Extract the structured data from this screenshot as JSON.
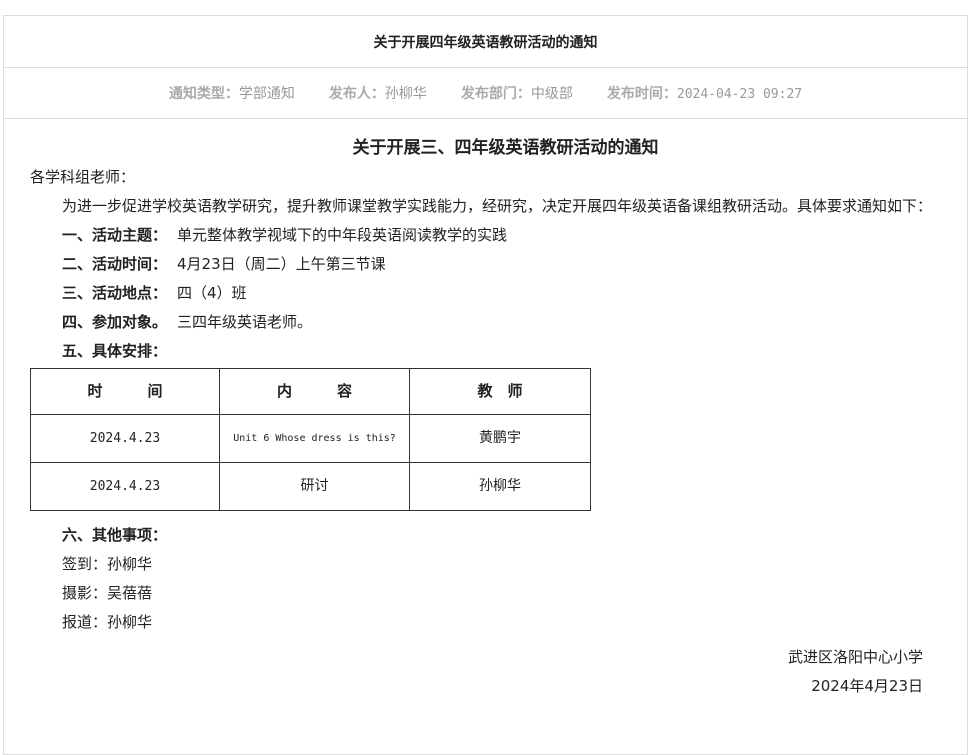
{
  "header": {
    "title": "关于开展四年级英语教研活动的通知"
  },
  "meta": {
    "type_label": "通知类型：",
    "type_value": "学部通知",
    "publisher_label": "发布人：",
    "publisher_value": "孙柳华",
    "dept_label": "发布部门：",
    "dept_value": "中级部",
    "time_label": "发布时间：",
    "time_value": "2024-04-23 09:27"
  },
  "document": {
    "title": "关于开展三、四年级英语教研活动的通知",
    "greeting": "各学科组老师：",
    "intro": "为进一步促进学校英语教学研究，提升教师课堂教学实践能力，经研究，决定开展四年级英语备课组教研活动。具体要求通知如下：",
    "items": [
      {
        "label": "一、活动主题：",
        "value": "单元整体教学视域下的中年段英语阅读教学的实践"
      },
      {
        "label": "二、活动时间：",
        "value": "4月23日（周二）上午第三节课"
      },
      {
        "label": "三、活动地点：",
        "value": "四（4）班"
      },
      {
        "label": "四、参加对象。",
        "value": "三四年级英语老师。"
      }
    ],
    "schedule_heading": "五、具体安排：",
    "table": {
      "headers": [
        "时　　　间",
        "内　　　容",
        "教　师"
      ],
      "rows": [
        [
          "2024.4.23",
          "Unit 6 Whose dress is this?",
          "黄鹏宇"
        ],
        [
          "2024.4.23",
          "研讨",
          "孙柳华"
        ]
      ]
    },
    "other_heading": "六、其他事项：",
    "others": [
      "签到：孙柳华",
      "摄影：吴蓓蓓",
      "报道：孙柳华"
    ],
    "signature_org": "武进区洛阳中心小学",
    "signature_date": "2024年4月23日"
  }
}
